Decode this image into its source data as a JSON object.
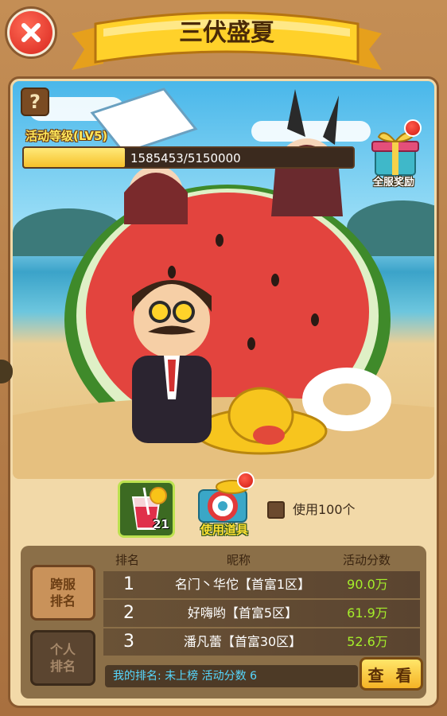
{
  "header": {
    "title": "三伏盛夏"
  },
  "help": {
    "icon": "question-mark-icon",
    "label": "?"
  },
  "activity": {
    "level_label": "活动等级(LV5)",
    "progress_text": "1585453/5150000",
    "progress_fraction": 0.3079
  },
  "server_reward": {
    "label": "全服奖励",
    "icon": "gift-box-icon"
  },
  "items": {
    "drink_count": "21",
    "drink_icon": "watermelon-juice-icon",
    "use_item_label": "使用道具",
    "use_item_icon": "lifebuoy-shop-icon",
    "use_amount_label": "使用100个"
  },
  "ranking": {
    "tabs": [
      {
        "label": "跨服排名"
      },
      {
        "label": "个人排名"
      }
    ],
    "headers": {
      "rank": "排名",
      "nickname": "昵称",
      "score": "活动分数"
    },
    "rows": [
      {
        "rank": "1",
        "name": "名门丶华佗【首富1区】",
        "score": "90.0万"
      },
      {
        "rank": "2",
        "name": "好嗨哟【首富5区】",
        "score": "61.9万"
      },
      {
        "rank": "3",
        "name": "潘凡蕾【首富30区】",
        "score": "52.6万"
      }
    ],
    "my_rank_text": "我的排名: 未上榜   活动分数  6",
    "view_button": "查 看"
  },
  "colors": {
    "accent_yellow": "#f6c12a",
    "score_green": "#a5ee2a",
    "close_red": "#d8261d",
    "my_rank_cyan": "#56d8ff"
  }
}
